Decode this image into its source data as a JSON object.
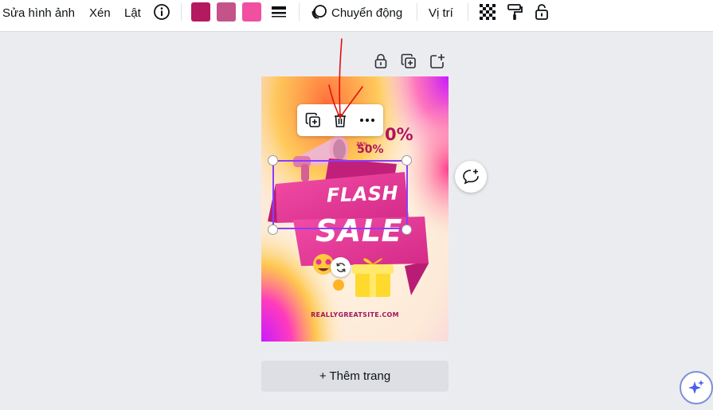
{
  "toolbar": {
    "edit_image": "Sửa hình ảnh",
    "crop": "Xén",
    "flip": "Lật",
    "info_icon": "info-icon",
    "colors": [
      "#b5195f",
      "#c4538a",
      "#f14fa0"
    ],
    "line_weight_icon": "line-weight-icon",
    "animate": "Chuyển động",
    "position": "Vị trí",
    "transparency_icon": "checkerboard-icon",
    "paint_roller_icon": "paint-roller-icon",
    "lock_icon": "lock-icon"
  },
  "page_controls": {
    "lock_icon": "lock-icon",
    "duplicate_icon": "duplicate-page-icon",
    "add_icon": "add-page-icon"
  },
  "floating_toolbar": {
    "copy_icon": "copy-icon",
    "delete_icon": "trash-icon",
    "more_icon": "more-icon"
  },
  "design": {
    "percent_1": "0%",
    "percent_2": "50%",
    "percent_small": "25%",
    "flash": "FLASH",
    "sale": "SALE",
    "website": "REALLYGREATSITE.COM"
  },
  "add_page": "+ Thêm trang",
  "comment_icon": "comment-add-icon",
  "magic_icon": "magic-sparkle-icon",
  "annotation": {
    "color": "#e01010"
  }
}
